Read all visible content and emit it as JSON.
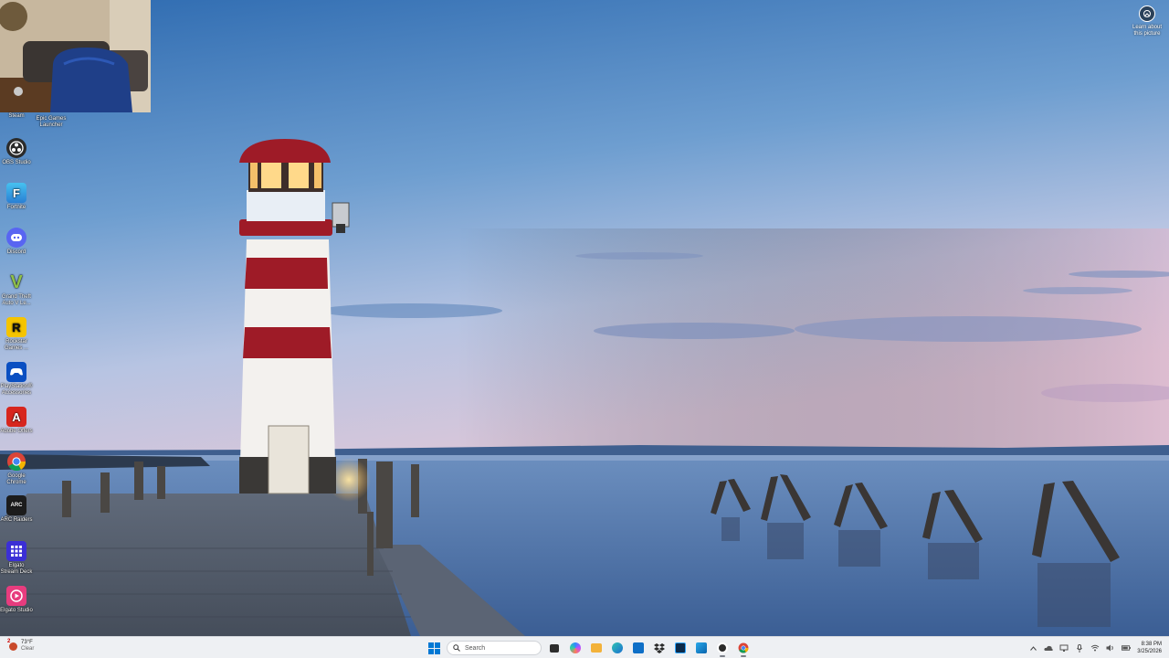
{
  "desktop": {
    "icons": [
      {
        "label": "Steam"
      },
      {
        "label": "Epic Games Launcher"
      },
      {
        "label": "OBS Studio"
      },
      {
        "label": "Fortnite"
      },
      {
        "label": "Discord"
      },
      {
        "label": "Grand Theft Auto V Le..."
      },
      {
        "label": "Rockstar Games ..."
      },
      {
        "label": "PlayStation® Accessories"
      },
      {
        "label": "Adobe Offers"
      },
      {
        "label": "Google Chrome"
      },
      {
        "label": "ARC Raiders"
      },
      {
        "label": "Elgato Stream Deck"
      },
      {
        "label": "Elgato Studio"
      }
    ],
    "learn_label": "Learn about this picture"
  },
  "taskbar": {
    "weather": {
      "temp": "73°F",
      "condition": "Clear",
      "badge": "2"
    },
    "search_placeholder": "Search",
    "pinned_icons": [
      "task-view-icon",
      "copilot-icon",
      "file-explorer-icon",
      "edge-icon",
      "microsoft-store-icon",
      "dropbox-icon",
      "photoshop-icon",
      "outlook-icon",
      "obs-icon",
      "chrome-icon"
    ],
    "clock": {
      "time": "8:38 PM",
      "date": "3/25/2026"
    }
  },
  "colors": {
    "taskbar_bg": "#eef0f3",
    "win_blue": "#0078d4",
    "lighthouse_red": "#9e1b27"
  }
}
